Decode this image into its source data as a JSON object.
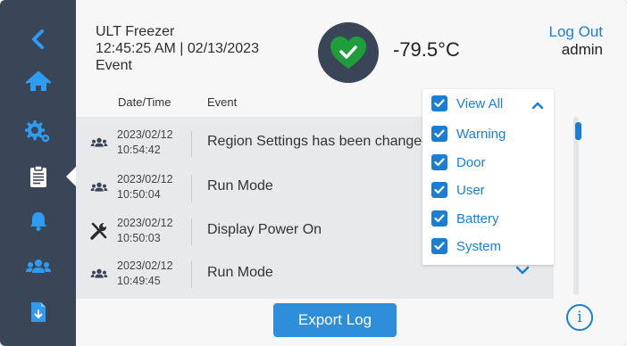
{
  "header": {
    "device_name": "ULT Freezer",
    "datetime": "12:45:25 AM | 02/13/2023",
    "section": "Event",
    "temperature": "-79.5°C",
    "status": "ok",
    "logout_label": "Log Out",
    "username": "admin"
  },
  "sidebar": {
    "items": [
      {
        "name": "back",
        "icon": "chevron-left-icon"
      },
      {
        "name": "home",
        "icon": "home-icon"
      },
      {
        "name": "settings",
        "icon": "gears-icon"
      },
      {
        "name": "event-log",
        "icon": "clipboard-icon",
        "active": true
      },
      {
        "name": "alarms",
        "icon": "bell-icon"
      },
      {
        "name": "users",
        "icon": "users-icon"
      },
      {
        "name": "export-file",
        "icon": "file-download-icon"
      }
    ]
  },
  "table": {
    "columns": [
      "Date/Time",
      "Event"
    ],
    "rows": [
      {
        "date": "2023/02/12",
        "time": "10:54:42",
        "event": "Region Settings has been changed",
        "icon": "users-icon"
      },
      {
        "date": "2023/02/12",
        "time": "10:50:04",
        "event": "Run Mode",
        "icon": "users-icon"
      },
      {
        "date": "2023/02/12",
        "time": "10:50:03",
        "event": "Display Power On",
        "icon": "tools-icon"
      },
      {
        "date": "2023/02/12",
        "time": "10:49:45",
        "event": "Run Mode",
        "icon": "users-icon"
      }
    ]
  },
  "filter": {
    "header_label": "View All",
    "options": [
      "Warning",
      "Door",
      "User",
      "Battery",
      "System"
    ]
  },
  "actions": {
    "export_label": "Export Log",
    "info_label": "i"
  },
  "colors": {
    "sidebar": "#3a4657",
    "accent": "#1a7fd4",
    "status_ok": "#1f9d3a"
  }
}
